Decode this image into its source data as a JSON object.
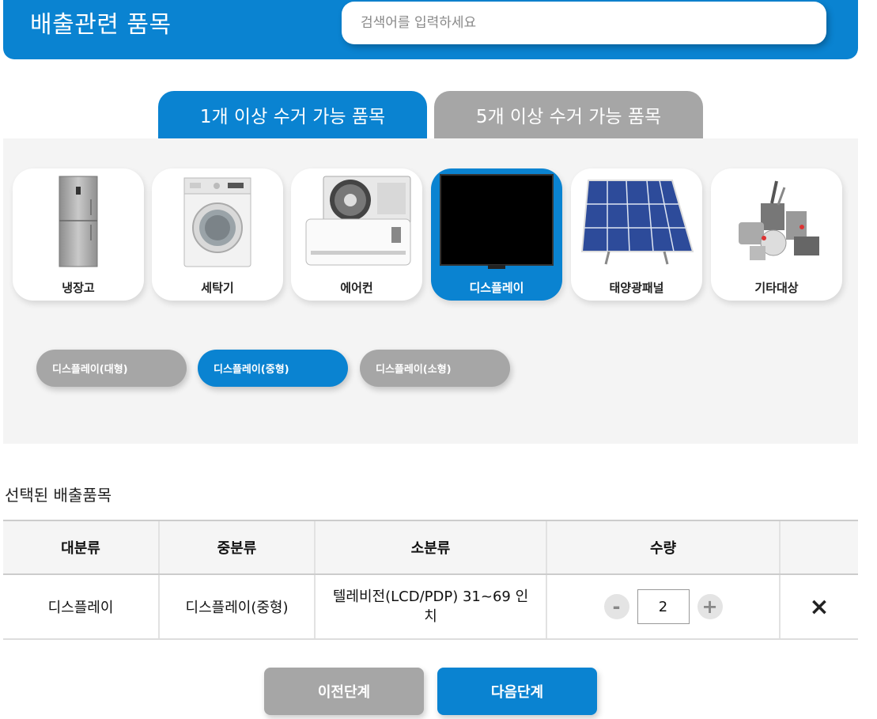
{
  "header": {
    "title": "배출관련 품목",
    "search_placeholder": "검색어를 입력하세요"
  },
  "tabs": [
    {
      "label": "1개 이상 수거 가능 품목",
      "active": true
    },
    {
      "label": "5개 이상 수거 가능 품목",
      "active": false
    }
  ],
  "categories": [
    {
      "label": "냉장고",
      "icon": "refrigerator-icon"
    },
    {
      "label": "세탁기",
      "icon": "washing-machine-icon"
    },
    {
      "label": "에어컨",
      "icon": "air-conditioner-icon"
    },
    {
      "label": "디스플레이",
      "icon": "display-icon",
      "active": true
    },
    {
      "label": "태양광패널",
      "icon": "solar-panel-icon"
    },
    {
      "label": "기타대상",
      "icon": "misc-appliances-icon"
    }
  ],
  "subcategories": [
    {
      "label": "디스플레이(대형)",
      "active": false
    },
    {
      "label": "디스플레이(중형)",
      "active": true
    },
    {
      "label": "디스플레이(소형)",
      "active": false
    }
  ],
  "selected": {
    "title": "선택된 배출품목",
    "headers": [
      "대분류",
      "중분류",
      "소분류",
      "수량",
      ""
    ],
    "rows": [
      {
        "major": "디스플레이",
        "middle": "디스플레이(중형)",
        "minor": "텔레비전(LCD/PDP) 31~69 인치",
        "qty": "2",
        "minus": "-",
        "plus": "+",
        "remove": "×"
      }
    ]
  },
  "buttons": {
    "prev": "이전단계",
    "next": "다음단계"
  },
  "colors": {
    "primary": "#0a83d1",
    "inactive": "#a6a6a6",
    "panel_bg": "#f4f4f4"
  }
}
